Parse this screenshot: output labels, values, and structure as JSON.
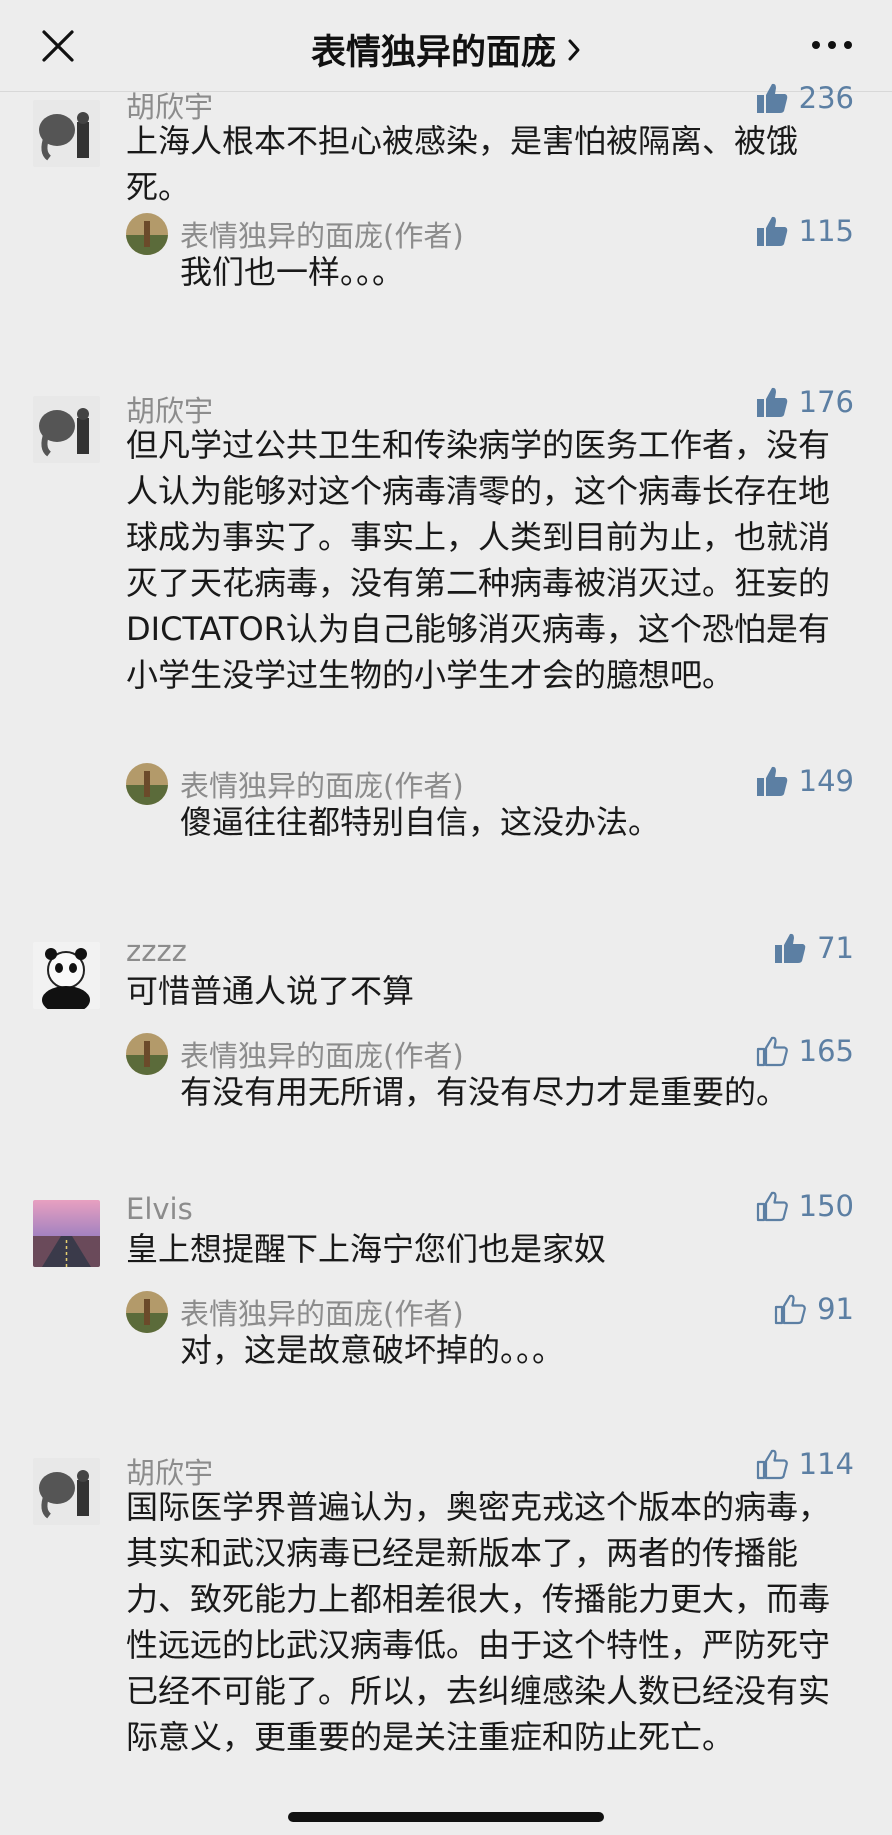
{
  "header": {
    "title": "表情独异的面庞"
  },
  "icons": {
    "close": "close-icon",
    "more": "more-dots-icon",
    "chevron": "chevron-right-icon",
    "like_filled": "thumbs-up-filled-icon",
    "like_outline": "thumbs-up-outline-icon"
  },
  "colors": {
    "like": "#5c7fa3",
    "background": "#ededed",
    "text": "#191919",
    "meta": "#8c8c8c"
  },
  "comments": [
    {
      "name": "胡欣宇",
      "likes": "236",
      "liked": true,
      "text": "上海人根本不担心被感染，是害怕被隔离、被饿死。",
      "reply": {
        "name": "表情独异的面庞(作者)",
        "likes": "115",
        "liked": true,
        "text": "我们也一样。。。"
      }
    },
    {
      "name": "胡欣宇",
      "likes": "176",
      "liked": true,
      "text": "但凡学过公共卫生和传染病学的医务工作者，没有人认为能够对这个病毒清零的，这个病毒长存在地球成为事实了。事实上，人类到目前为止，也就消灭了天花病毒，没有第二种病毒被消灭过。狂妄的DICTATOR认为自己能够消灭病毒，这个恐怕是有小学生没学过生物的小学生才会的臆想吧。",
      "reply": {
        "name": "表情独异的面庞(作者)",
        "likes": "149",
        "liked": true,
        "text": "傻逼往往都特别自信，这没办法。"
      }
    },
    {
      "name": "zzzz",
      "likes": "71",
      "liked": true,
      "text": "可惜普通人说了不算",
      "reply": {
        "name": "表情独异的面庞(作者)",
        "likes": "165",
        "liked": false,
        "text": "有没有用无所谓，有没有尽力才是重要的。"
      }
    },
    {
      "name": "Elvis",
      "likes": "150",
      "liked": false,
      "text": "皇上想提醒下上海宁您们也是家奴",
      "reply": {
        "name": "表情独异的面庞(作者)",
        "likes": "91",
        "liked": false,
        "text": "对，这是故意破坏掉的。。。"
      }
    },
    {
      "name": "胡欣宇",
      "likes": "114",
      "liked": false,
      "text": "国际医学界普遍认为，奥密克戎这个版本的病毒，其实和武汉病毒已经是新版本了，两者的传播能力、致死能力上都相差很大，传播能力更大，而毒性远远的比武汉病毒低。由于这个特性，严防死守已经不可能了。所以，去纠缠感染人数已经没有实际意义，更重要的是关注重症和防止死亡。"
    }
  ]
}
